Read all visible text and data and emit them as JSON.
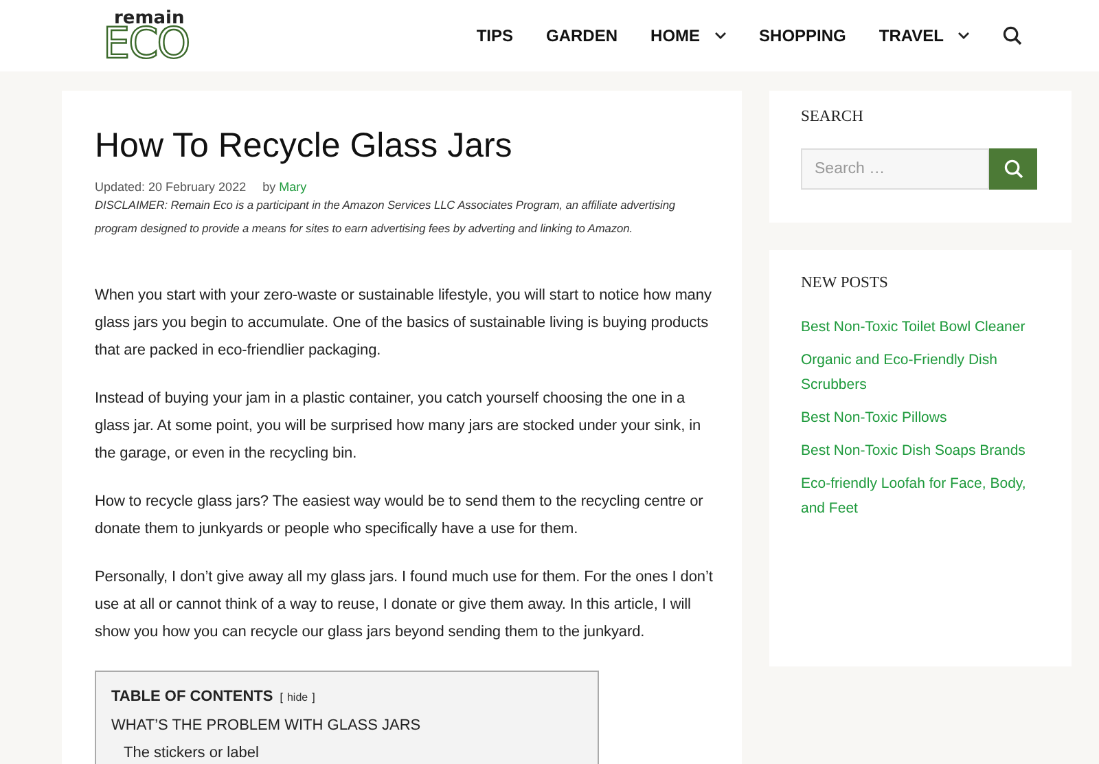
{
  "header": {
    "logo": {
      "top": "remain",
      "main": "ECO"
    },
    "nav": [
      {
        "label": "TIPS",
        "dropdown": false
      },
      {
        "label": "GARDEN",
        "dropdown": false
      },
      {
        "label": "HOME",
        "dropdown": true
      },
      {
        "label": "SHOPPING",
        "dropdown": false
      },
      {
        "label": "TRAVEL",
        "dropdown": true
      }
    ]
  },
  "article": {
    "title": "How To Recycle Glass Jars",
    "updated": "Updated: 20 February 2022",
    "by": "by",
    "author": "Mary",
    "disclaimer": "DISCLAIMER: Remain Eco is a participant in the Amazon Services LLC Associates Program, an affiliate advertising program designed to provide a means for sites to earn advertising fees by adverting and linking to Amazon.",
    "paragraphs": [
      "When you start with your zero-waste or sustainable lifestyle, you will start to notice how many glass jars you begin to accumulate. One of the basics of sustainable living is buying products that are packed in eco-friendlier packaging.",
      "Instead of buying your jam in a plastic container, you catch yourself choosing the one in a glass jar. At some point, you will be surprised how many jars are stocked under your sink, in the garage, or even in the recycling bin.",
      "How to recycle glass jars? The easiest way would be to send them to the recycling centre or donate them to junkyards or people who specifically have a use for them.",
      "Personally, I don’t give away all my glass jars. I found much use for them. For the ones I don’t use at all or cannot think of a way to reuse, I donate or give them away. In this article, I will show you how you can recycle our glass jars beyond sending them to the junkyard."
    ],
    "toc": {
      "title": "TABLE OF CONTENTS",
      "toggle_open": "[",
      "toggle": "hide",
      "toggle_close": "]",
      "items": [
        {
          "label": "WHAT’S THE PROBLEM WITH GLASS JARS",
          "children": [
            {
              "label": "The stickers or label"
            }
          ]
        }
      ]
    }
  },
  "sidebar": {
    "search": {
      "heading": "SEARCH",
      "placeholder": "Search …"
    },
    "new_posts": {
      "heading": "NEW POSTS",
      "items": [
        "Best Non-Toxic Toilet Bowl Cleaner",
        "Organic and Eco-Friendly Dish Scrubbers",
        "Best Non-Toxic Pillows",
        "Best Non-Toxic Dish Soaps Brands",
        "Eco-friendly Loofah for Face, Body, and Feet"
      ]
    }
  }
}
